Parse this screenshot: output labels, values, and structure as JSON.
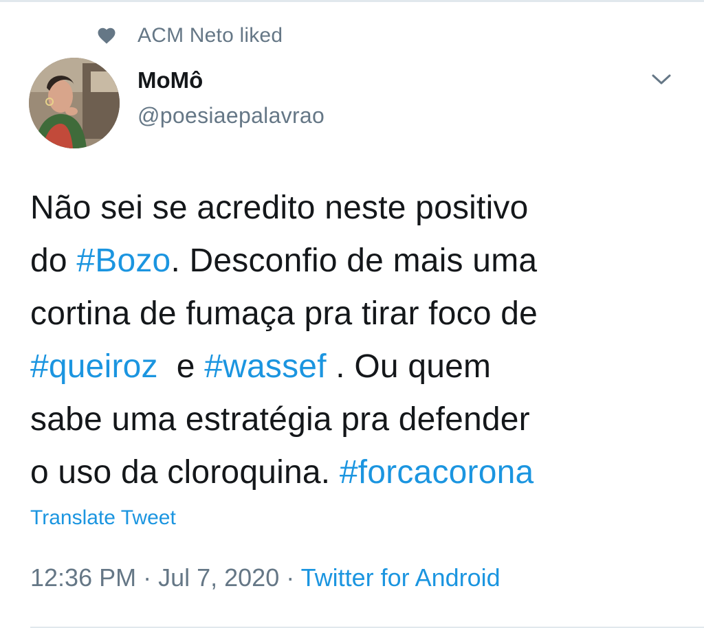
{
  "social_context": {
    "icon": "heart-icon",
    "text": "ACM Neto liked"
  },
  "author": {
    "name": "MoMô",
    "handle": "@poesiaepalavrao"
  },
  "menu": {
    "icon": "chevron-down-icon"
  },
  "tweet": {
    "lines": [
      [
        {
          "text": "Não sei se acredito neste positivo",
          "type": "text"
        }
      ],
      [
        {
          "text": "do ",
          "type": "text"
        },
        {
          "text": "#Bozo",
          "type": "hashtag"
        },
        {
          "text": ". Desconfio de mais uma",
          "type": "text"
        }
      ],
      [
        {
          "text": "cortina de fumaça pra tirar foco de",
          "type": "text"
        }
      ],
      [
        {
          "text": "#queiroz",
          "type": "hashtag"
        },
        {
          "text": "  e ",
          "type": "text"
        },
        {
          "text": "#wassef",
          "type": "hashtag"
        },
        {
          "text": " . Ou quem",
          "type": "text"
        }
      ],
      [
        {
          "text": "sabe uma estratégia pra defender",
          "type": "text"
        }
      ],
      [
        {
          "text": "o uso da cloroquina. ",
          "type": "text"
        },
        {
          "text": "#forcacorona",
          "type": "hashtag"
        }
      ]
    ]
  },
  "translate_label": "Translate Tweet",
  "meta": {
    "time": "12:36 PM",
    "separator": " · ",
    "date": "Jul 7, 2020",
    "source": "Twitter for Android"
  },
  "colors": {
    "link": "#1b95e0",
    "secondary": "#657786",
    "primary_text": "#14171a",
    "divider": "#e1e8ed"
  }
}
